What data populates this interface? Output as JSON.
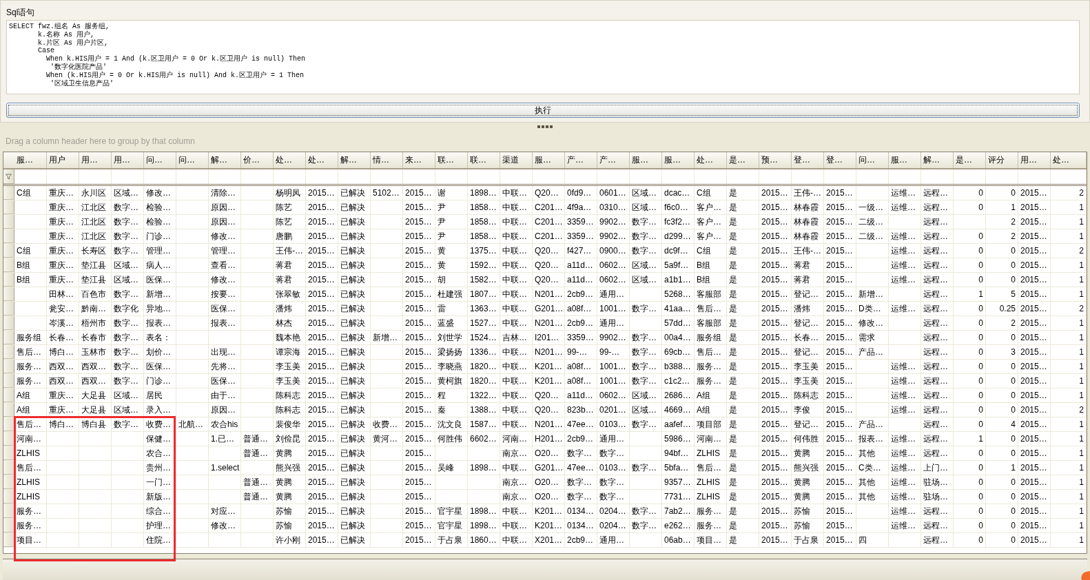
{
  "sql_panel": {
    "title": "Sql语句",
    "sql_lines": [
      "SELECT fwz.组名 As 服务组,",
      "       k.名称 As 用户,",
      "       k.片区 As 用户片区,",
      "       Case",
      "         When k.HIS用户 = 1 And (k.区卫用户 = 0 Or k.区卫用户 is null) Then",
      "          '数字化医院产品'",
      "         When (k.HIS用户 = 0 Or k.HIS用户 is null) And k.区卫用户 = 1 Then",
      "          '区域卫生信息产品'"
    ],
    "execute_button": "执行"
  },
  "grid": {
    "group_hint": "Drag a column header here to group by that column",
    "columns": [
      {
        "label": "服…",
        "kind": "text"
      },
      {
        "label": "用户",
        "kind": "text"
      },
      {
        "label": "用…",
        "kind": "text"
      },
      {
        "label": "用…",
        "kind": "text"
      },
      {
        "label": "问…",
        "kind": "text"
      },
      {
        "label": "问…",
        "kind": "text"
      },
      {
        "label": "解…",
        "kind": "text"
      },
      {
        "label": "价…",
        "kind": "text"
      },
      {
        "label": "处…",
        "kind": "text"
      },
      {
        "label": "处…",
        "kind": "text"
      },
      {
        "label": "解…",
        "kind": "text"
      },
      {
        "label": "情…",
        "kind": "text"
      },
      {
        "label": "来…",
        "kind": "text"
      },
      {
        "label": "联…",
        "kind": "text"
      },
      {
        "label": "联…",
        "kind": "text"
      },
      {
        "label": "渠道",
        "kind": "text"
      },
      {
        "label": "服…",
        "kind": "text"
      },
      {
        "label": "产…",
        "kind": "text"
      },
      {
        "label": "产…",
        "kind": "text"
      },
      {
        "label": "服…",
        "kind": "text"
      },
      {
        "label": "服…",
        "kind": "text"
      },
      {
        "label": "处…",
        "kind": "text"
      },
      {
        "label": "是…",
        "kind": "text"
      },
      {
        "label": "预…",
        "kind": "text"
      },
      {
        "label": "登…",
        "kind": "text"
      },
      {
        "label": "登…",
        "kind": "text"
      },
      {
        "label": "问…",
        "kind": "text"
      },
      {
        "label": "服…",
        "kind": "text"
      },
      {
        "label": "解…",
        "kind": "text"
      },
      {
        "label": "是…",
        "kind": "number"
      },
      {
        "label": "评分",
        "kind": "number"
      },
      {
        "label": "用…",
        "kind": "text"
      },
      {
        "label": "处…",
        "kind": "number"
      }
    ],
    "rows": [
      [
        "C组",
        "重庆…",
        "永川区",
        "区域…",
        "修改…",
        null,
        "清除…",
        null,
        "杨明凤",
        "2015…",
        "已解决",
        "5102…",
        "2015…",
        "谢",
        "1898…",
        "中联…",
        "Q20…",
        "0fd9…",
        "0601…",
        "区域…",
        "dcac…",
        "C组",
        "是",
        "2015…",
        "王伟-…",
        "2015…",
        null,
        "运维…",
        "远程…",
        "0",
        "0",
        "2015…",
        "2"
      ],
      [
        null,
        "重庆…",
        "江北区",
        "数字…",
        "检验…",
        null,
        "原因…",
        null,
        "陈艺",
        "2015…",
        "已解决",
        null,
        "2015…",
        "尹",
        "1858…",
        "中联…",
        "C201…",
        "4f9a…",
        "0310…",
        "区域…",
        "f6c0…",
        "客户…",
        "是",
        "2015…",
        "林春霞",
        "2015…",
        "一级…",
        "运维…",
        "远程…",
        "0",
        "1",
        "2015…",
        "1"
      ],
      [
        null,
        "重庆…",
        "江北区",
        "数字…",
        "检验…",
        null,
        "原因…",
        null,
        "陈艺",
        "2015…",
        "已解决",
        null,
        "2015…",
        "尹",
        "1858…",
        "中联…",
        "C201…",
        "3359…",
        "9902…",
        "数字…",
        "fc3f2…",
        "客户…",
        "是",
        "2015…",
        "林春霞",
        "2015…",
        "二级…",
        null,
        "远程…",
        null,
        "2",
        "2015…",
        "1"
      ],
      [
        null,
        "重庆…",
        "江北区",
        "数字…",
        "门诊…",
        null,
        "修改…",
        null,
        "唐鹏",
        "2015…",
        "已解决",
        null,
        "2015…",
        "尹",
        "1858…",
        "中联…",
        "C201…",
        "3359…",
        "9902…",
        "数字…",
        "d299…",
        "客户…",
        "是",
        "2015…",
        "林春霞",
        "2015…",
        "二级…",
        "运维…",
        "远程…",
        "0",
        "2",
        "2015…",
        "1"
      ],
      [
        "C组",
        "重庆…",
        "长寿区",
        "数字…",
        "管理…",
        null,
        "管理…",
        null,
        "王伟-…",
        "2015…",
        "已解决",
        null,
        "2015…",
        "黄",
        "1375…",
        "中联…",
        "Q20…",
        "f427…",
        "0900…",
        "数字…",
        "dc9f…",
        "C组",
        "是",
        "2015…",
        "王伟-…",
        "2015…",
        null,
        "运维…",
        "远程…",
        "0",
        "0",
        "2015…",
        "2"
      ],
      [
        "B组",
        "重庆…",
        "垫江县",
        "区域…",
        "病人…",
        null,
        "查看…",
        null,
        "蒋君",
        "2015…",
        "已解决",
        null,
        "2015…",
        "黄",
        "1592…",
        "中联…",
        "Q20…",
        "a11d…",
        "0602…",
        "区域…",
        "5a9f…",
        "B组",
        "是",
        "2015…",
        "蒋君",
        "2015…",
        null,
        "运维…",
        "远程…",
        "0",
        "0",
        "2015…",
        "1"
      ],
      [
        "B组",
        "重庆…",
        "垫江县",
        "区域…",
        "医保…",
        null,
        "修改…",
        null,
        "蒋君",
        "2015…",
        "已解决",
        null,
        "2015…",
        "胡",
        "1582…",
        "中联…",
        "Q20…",
        "a11d…",
        "0602…",
        "区域…",
        "a1b1…",
        "B组",
        "是",
        "2015…",
        "蒋君",
        "2015…",
        null,
        "运维…",
        "远程…",
        "0",
        "0",
        "2015…",
        "1"
      ],
      [
        null,
        "田林…",
        "百色市",
        "数字…",
        "新增…",
        null,
        "按要…",
        null,
        "张翠敏",
        "2015…",
        "已解决",
        null,
        "2015…",
        "杜建强",
        "1807…",
        "中联…",
        "N201…",
        "2cb9…",
        "通用…",
        null,
        "5268…",
        "客服部",
        "是",
        "2015…",
        "登记…",
        "2015…",
        "新增…",
        null,
        "远程…",
        "1",
        "5",
        "2015…",
        "1"
      ],
      [
        null,
        "瓮安…",
        "黔南…",
        "数字化",
        "异地…",
        null,
        "医保…",
        null,
        "潘炜",
        "2015…",
        "已解决",
        null,
        "2015…",
        "雷",
        "1363…",
        "中联…",
        "G201…",
        "a08f…",
        "1001…",
        "数字…",
        "41aa…",
        "售后…",
        "是",
        "2015…",
        "潘炜",
        "2015…",
        "D类…",
        "运维…",
        "远程…",
        "0",
        "0.25",
        "2015…",
        "2"
      ],
      [
        null,
        "岑溪…",
        "梧州市",
        "数字…",
        "报表…",
        null,
        "报表…",
        null,
        "林杰",
        "2015…",
        "已解决",
        null,
        "2015…",
        "蓝盛",
        "1527…",
        "中联…",
        "N201…",
        "2cb9…",
        "通用…",
        null,
        "57dd…",
        "客服部",
        "是",
        "2015…",
        "登记…",
        "2015…",
        "修改…",
        null,
        "远程…",
        "0",
        "2",
        "2015…",
        "1"
      ],
      [
        "服务组",
        "长春…",
        "长春市",
        "数字…",
        "表名：",
        null,
        null,
        null,
        "魏本艳",
        "2015…",
        "已解决",
        "新增…",
        "2015…",
        "刘世学",
        "1524…",
        "吉林…",
        "I201…",
        "3359…",
        "9902…",
        "数字…",
        "00a4…",
        "服务组",
        "是",
        "2015…",
        "长春…",
        "2015…",
        "需求",
        null,
        "远程…",
        "0",
        "0",
        "2015…",
        "1"
      ],
      [
        "售后…",
        "博白…",
        "玉林市",
        "数字…",
        "划价…",
        null,
        "出现…",
        null,
        "谭宗海",
        "2015…",
        "已解决",
        null,
        "2015…",
        "梁扬扬",
        "1336…",
        "中联…",
        "N201…",
        "99-…",
        "99-…",
        "数字…",
        "69cb…",
        "售后…",
        "是",
        "2015…",
        "登记…",
        "2015…",
        "产品…",
        null,
        "远程…",
        "0",
        "3",
        "2015…",
        "1"
      ],
      [
        "服务…",
        "西双…",
        "西双…",
        "数字…",
        "医保…",
        null,
        "先将…",
        null,
        "李玉美",
        "2015…",
        "已解决",
        null,
        "2015…",
        "李晓燕",
        "1820…",
        "中联…",
        "K201…",
        "a08f…",
        "1001…",
        "数字…",
        "b388…",
        "服务…",
        "是",
        "2015…",
        "李玉美",
        "2015…",
        null,
        "运维…",
        "远程…",
        "0",
        "0",
        "2015…",
        "1"
      ],
      [
        "服务…",
        "西双…",
        "西双…",
        "数字…",
        "门诊…",
        null,
        "医保…",
        null,
        "李玉美",
        "2015…",
        "已解决",
        null,
        "2015…",
        "黄柯旗",
        "1820…",
        "中联…",
        "K201…",
        "a08f…",
        "1001…",
        "数字…",
        "c1c2…",
        "服务…",
        "是",
        "2015…",
        "李玉美",
        "2015…",
        null,
        "运维…",
        "远程…",
        "0",
        "0",
        "2015…",
        "1"
      ],
      [
        "A组",
        "重庆…",
        "大足县",
        "区域…",
        "居民",
        null,
        "由于…",
        null,
        "陈科志",
        "2015…",
        "已解决",
        null,
        "2015…",
        "程",
        "1322…",
        "中联…",
        "Q20…",
        "a11d…",
        "0602…",
        "区域…",
        "2686…",
        "A组",
        "是",
        "2015…",
        "陈科志",
        "2015…",
        null,
        "运维…",
        "远程…",
        "0",
        "0",
        "2015…",
        "1"
      ],
      [
        "A组",
        "重庆…",
        "大足县",
        "区域…",
        "录入…",
        null,
        "原因…",
        null,
        "陈科志",
        "2015…",
        "已解决",
        null,
        "2015…",
        "秦",
        "1388…",
        "中联…",
        "Q20…",
        "823b…",
        "0201…",
        "区域…",
        "4669…",
        "A组",
        "是",
        "2015…",
        "李俊",
        "2015…",
        null,
        "运维…",
        "远程…",
        "0",
        "0",
        "2015…",
        "2"
      ],
      [
        "售后…",
        "博白…",
        "博白县",
        "数字…",
        "收费…",
        "北航…",
        "农合his",
        null,
        "裴俊华",
        "2015…",
        "已解决",
        "收费…",
        "2015…",
        "沈文良",
        "1587…",
        "中联…",
        "N201…",
        "47ee…",
        "0103…",
        "数字…",
        "aafef…",
        "项目部",
        "是",
        "2015…",
        "登记…",
        "2015…",
        "产品…",
        null,
        "远程…",
        "0",
        "4",
        "2015…",
        "1"
      ],
      [
        "河南…",
        null,
        null,
        null,
        "保健…",
        null,
        "1.已…",
        "普通…",
        "刘俭昆",
        "2015…",
        "已解决",
        "黄河…",
        "2015…",
        "何胜伟",
        "6602…",
        "河南…",
        "H201…",
        "2cb9…",
        "通用…",
        null,
        "5986…",
        "河南…",
        "是",
        "2015…",
        "何伟胜",
        "2015…",
        "报表…",
        "运维…",
        "远程…",
        "1",
        "0",
        "2015…",
        "1"
      ],
      [
        "ZLHIS",
        null,
        null,
        null,
        "农合…",
        null,
        null,
        "普通…",
        "黄腾",
        "2015…",
        "已解决",
        null,
        "2015…",
        null,
        null,
        "南京…",
        "O20…",
        "数字…",
        "数字…",
        null,
        "94bf…",
        "ZLHIS",
        "是",
        "2015…",
        "黄腾",
        "2015…",
        "其他",
        "运维…",
        "远程…",
        "0",
        "0",
        "2015…",
        "1"
      ],
      [
        "售后…",
        null,
        null,
        null,
        "贵州…",
        null,
        "1.select",
        null,
        "熊兴强",
        "2015…",
        "已解决",
        null,
        "2015…",
        "吴峰",
        "1898…",
        "中联…",
        "G201…",
        "47ee…",
        "0103…",
        "数字…",
        "5bfa…",
        "售后…",
        "是",
        "2015…",
        "熊兴强",
        "2015…",
        "C类…",
        "运维…",
        "上门…",
        "0",
        "1",
        "2015…",
        "1"
      ],
      [
        "ZLHIS",
        null,
        null,
        null,
        "一门…",
        null,
        null,
        "普通…",
        "黄腾",
        "2015…",
        "已解决",
        null,
        "2015…",
        null,
        null,
        "南京…",
        "O20…",
        "数字…",
        "数字…",
        null,
        "9357…",
        "ZLHIS",
        "是",
        "2015…",
        "黄腾",
        "2015…",
        "其他",
        "运维…",
        "驻场…",
        "0",
        "0",
        "2015…",
        "1"
      ],
      [
        "ZLHIS",
        null,
        null,
        null,
        "新版…",
        null,
        null,
        "普通…",
        "黄腾",
        "2015…",
        "已解决",
        null,
        "2015…",
        null,
        null,
        "南京…",
        "O20…",
        "数字…",
        "数字…",
        null,
        "7731…",
        "ZLHIS",
        "是",
        "2015…",
        "黄腾",
        "2015…",
        "其他",
        "运维…",
        "驻场…",
        "0",
        "0",
        "2015…",
        "1"
      ],
      [
        "服务…",
        null,
        null,
        null,
        "综合…",
        null,
        "对应…",
        null,
        "苏愉",
        "2015…",
        "已解决",
        null,
        "2015…",
        "官宇星",
        "1898…",
        "中联…",
        "K201…",
        "0134…",
        "0204…",
        "数字…",
        "7ab2…",
        "服务…",
        "是",
        "2015…",
        "苏愉",
        "2015…",
        null,
        "运维…",
        "远程…",
        "0",
        "0",
        "2015…",
        "1"
      ],
      [
        "服务…",
        null,
        null,
        null,
        "护理…",
        null,
        "修改…",
        null,
        "苏愉",
        "2015…",
        "已解决",
        null,
        "2015…",
        "官宇星",
        "1898…",
        "中联…",
        "K201…",
        "0134…",
        "0204…",
        "数字…",
        "e262…",
        "服务…",
        "是",
        "2015…",
        "苏愉",
        "2015…",
        null,
        "运维…",
        "远程…",
        "0",
        "0",
        "2015…",
        "1"
      ],
      [
        "项目…",
        null,
        null,
        null,
        "住院…",
        null,
        null,
        null,
        "许小刚",
        "2015…",
        "已解决",
        null,
        "2015…",
        "于占泉",
        "1860…",
        "中联…",
        "X201…",
        "2cb9…",
        "通用…",
        null,
        "06ab…",
        "项目…",
        "是",
        "2015…",
        "于占泉",
        "2015…",
        "四",
        null,
        "远程…",
        "0",
        "0",
        "2015…",
        "1"
      ]
    ]
  },
  "annotation": {
    "kind": "rectangle"
  }
}
